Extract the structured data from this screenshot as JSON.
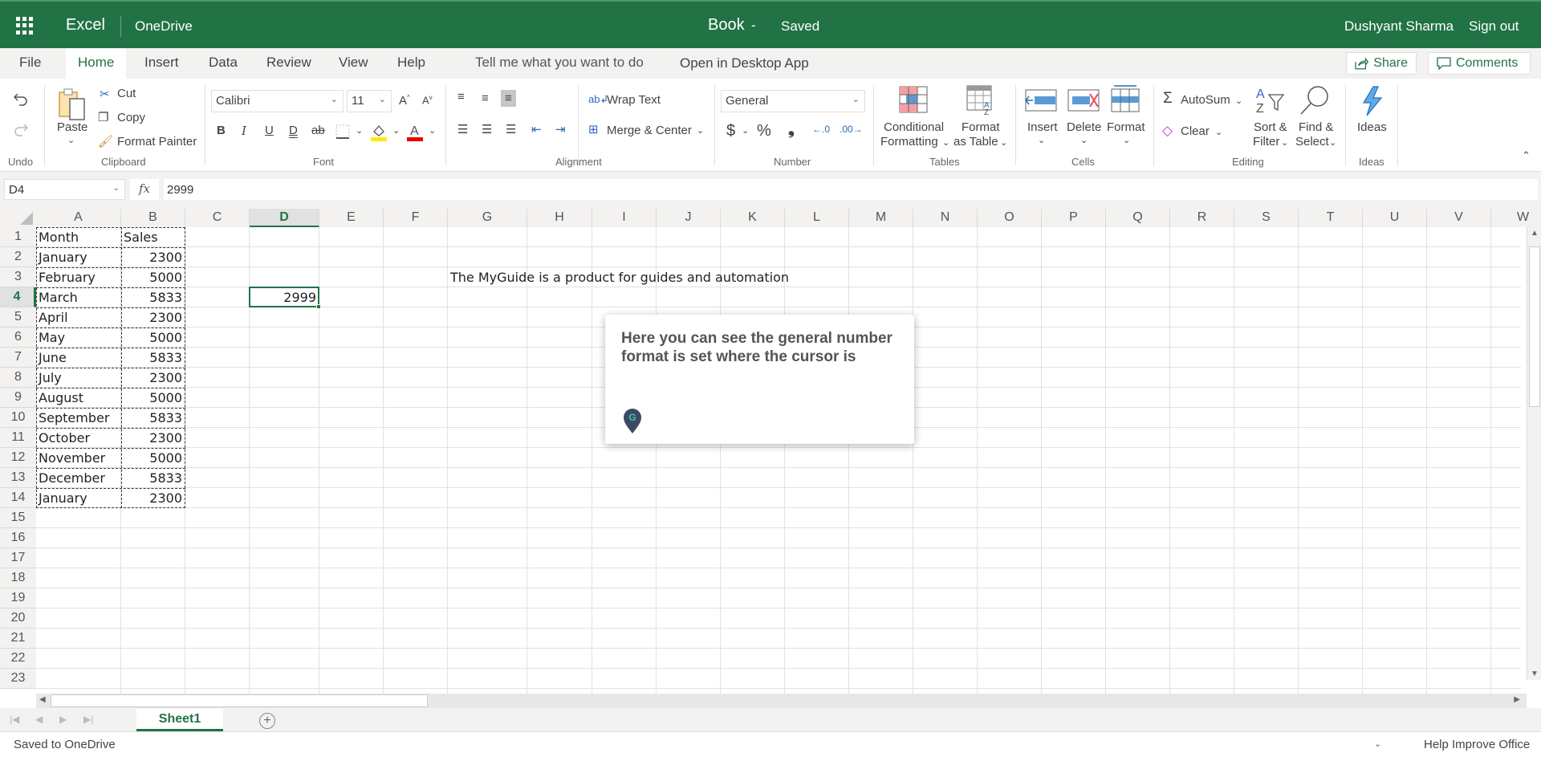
{
  "topbar": {
    "app_name": "Excel",
    "service": "OneDrive",
    "doc_title": "Book",
    "separator": "-",
    "save_status": "Saved",
    "user_name": "Dushyant Sharma",
    "sign_out": "Sign out"
  },
  "tabs": [
    {
      "label": "File"
    },
    {
      "label": "Home",
      "active": true
    },
    {
      "label": "Insert"
    },
    {
      "label": "Data"
    },
    {
      "label": "Review"
    },
    {
      "label": "View"
    },
    {
      "label": "Help"
    }
  ],
  "tell_me": "Tell me what you want to do",
  "open_desktop": "Open in Desktop App",
  "share_label": "Share",
  "comments_label": "Comments",
  "ribbon": {
    "undo_group": "Undo",
    "clipboard": {
      "group": "Clipboard",
      "paste": "Paste",
      "cut": "Cut",
      "copy": "Copy",
      "format_painter": "Format Painter"
    },
    "font": {
      "group": "Font",
      "family": "Calibri",
      "size": "11",
      "bold": "B",
      "italic": "I",
      "underline": "U",
      "double_underline": "D",
      "strike": "ab"
    },
    "alignment": {
      "group": "Alignment",
      "wrap_text": "Wrap Text",
      "merge_center": "Merge & Center"
    },
    "number": {
      "group": "Number",
      "format": "General",
      "currency": "$",
      "percent": "%",
      "comma": "9"
    },
    "tables": {
      "group": "Tables",
      "conditional_1": "Conditional",
      "conditional_2": "Formatting",
      "format_table_1": "Format",
      "format_table_2": "as Table"
    },
    "cells": {
      "group": "Cells",
      "insert": "Insert",
      "delete": "Delete",
      "format": "Format"
    },
    "editing": {
      "group": "Editing",
      "autosum": "AutoSum",
      "clear": "Clear",
      "sort_1": "Sort &",
      "sort_2": "Filter",
      "find_1": "Find &",
      "find_2": "Select"
    },
    "ideas": {
      "group": "Ideas",
      "label": "Ideas"
    }
  },
  "formula_bar": {
    "name_box": "D4",
    "fx": "fx",
    "value": "2999"
  },
  "columns": [
    "A",
    "B",
    "C",
    "D",
    "E",
    "F",
    "G",
    "H",
    "I",
    "J",
    "K",
    "L",
    "M",
    "N",
    "O",
    "P",
    "Q",
    "R",
    "S",
    "T",
    "U",
    "V",
    "W"
  ],
  "rows": [
    "1",
    "2",
    "3",
    "4",
    "5",
    "6",
    "7",
    "8",
    "9",
    "10",
    "11",
    "12",
    "13",
    "14",
    "15",
    "16",
    "17",
    "18",
    "19",
    "20",
    "21",
    "22",
    "23"
  ],
  "selected_cell": {
    "col": "D",
    "row": "4"
  },
  "cells": {
    "A1": "Month",
    "B1": "Sales",
    "A2": "January",
    "B2": "2300",
    "A3": "February",
    "B3": "5000",
    "A4": "March",
    "B4": "5833",
    "A5": "April",
    "B5": "2300",
    "A6": "May",
    "B6": "5000",
    "A7": "June",
    "B7": "5833",
    "A8": "July",
    "B8": "2300",
    "A9": "August",
    "B9": "5000",
    "A10": "September",
    "B10": "5833",
    "A11": "October",
    "B11": "2300",
    "A12": "November",
    "B12": "5000",
    "A13": "December",
    "B13": "5833",
    "A14": "January",
    "B14": "2300",
    "D4": "2999",
    "G3": "The MyGuide is a product for guides and automation"
  },
  "sheet_tabs": [
    {
      "label": "Sheet1",
      "active": true
    }
  ],
  "status": {
    "left": "Saved to OneDrive",
    "right": "Help Improve Office"
  },
  "guide_popup": {
    "message": "Here you can see the general number format is set where the cursor is",
    "logo_letter": "G"
  },
  "colors": {
    "brand": "#217346",
    "popup_logo": "#3d4a63",
    "popup_logo_accent": "#3ec6b0"
  }
}
